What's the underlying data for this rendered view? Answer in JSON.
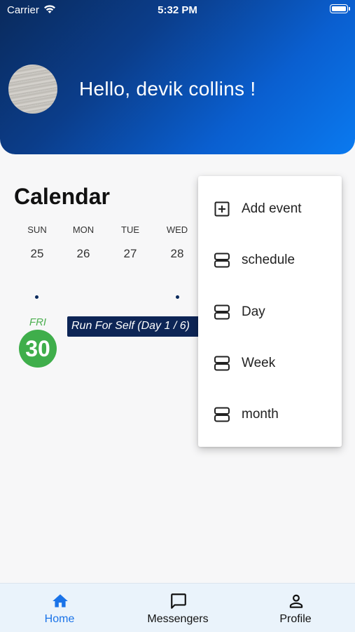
{
  "status_bar": {
    "carrier": "Carrier",
    "time": "5:32 PM"
  },
  "header": {
    "greeting": "Hello, devik collins !"
  },
  "calendar": {
    "title": "Calendar",
    "days": [
      {
        "name": "SUN",
        "number": "25",
        "has_event": true
      },
      {
        "name": "MON",
        "number": "26",
        "has_event": false
      },
      {
        "name": "TUE",
        "number": "27",
        "has_event": false
      },
      {
        "name": "WED",
        "number": "28",
        "has_event": true
      }
    ],
    "today": {
      "name": "FRI",
      "number": "30"
    },
    "event": "Run For Self (Day 1 / 6)"
  },
  "menu": {
    "items": [
      {
        "label": "Add event",
        "icon": "add-box-icon"
      },
      {
        "label": "schedule",
        "icon": "view-agenda-icon"
      },
      {
        "label": "Day",
        "icon": "view-agenda-icon"
      },
      {
        "label": "Week",
        "icon": "view-agenda-icon"
      },
      {
        "label": "month",
        "icon": "view-agenda-icon"
      }
    ]
  },
  "bottom_nav": {
    "items": [
      {
        "label": "Home",
        "icon": "home-icon",
        "active": true
      },
      {
        "label": "Messengers",
        "icon": "chat-icon",
        "active": false
      },
      {
        "label": "Profile",
        "icon": "person-icon",
        "active": false
      }
    ],
    "active_color": "#1a73e8"
  }
}
